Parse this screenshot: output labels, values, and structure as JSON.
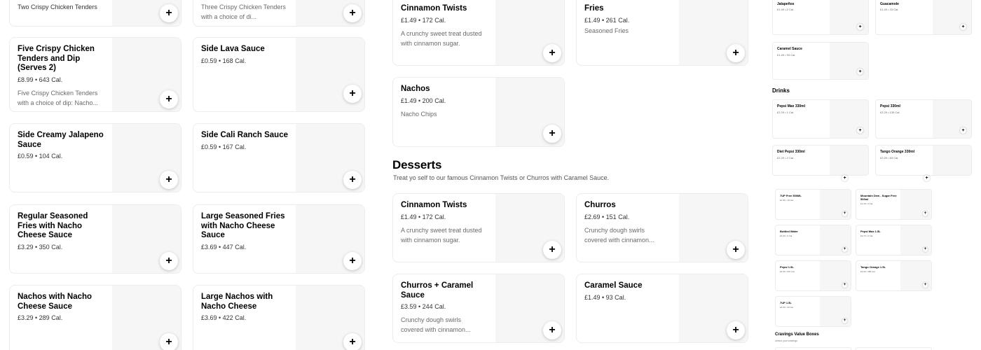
{
  "add_icon": "+",
  "col1": [
    {
      "name": "Two Crispy Chicken Tenders",
      "meta": "",
      "desc": ""
    },
    {
      "name": "Five Crispy Chicken Tenders and Dip (Serves 2)",
      "meta": "£8.99 • 643 Cal.",
      "desc": "Five Crispy Chicken Tenders with a choice of dip: Nacho..."
    },
    {
      "name": "Side Creamy Jalapeno Sauce",
      "meta": "£0.59 • 104 Cal.",
      "desc": ""
    },
    {
      "name": "Regular Seasoned Fries with Nacho Cheese Sauce",
      "meta": "£3.29 • 350 Cal.",
      "desc": ""
    },
    {
      "name": "Nachos with Nacho Cheese Sauce",
      "meta": "£3.29 • 289 Cal.",
      "desc": ""
    }
  ],
  "col2": [
    {
      "name": "",
      "meta": "",
      "desc": "Three Crispy Chicken Tenders with a choice of di..."
    },
    {
      "name": "Side Lava Sauce",
      "meta": "£0.59 • 168 Cal.",
      "desc": ""
    },
    {
      "name": "Side Cali Ranch Sauce",
      "meta": "£0.59 • 167 Cal.",
      "desc": ""
    },
    {
      "name": "Large Seasoned Fries with Nacho Cheese Sauce",
      "meta": "£3.69 • 447 Cal.",
      "desc": ""
    },
    {
      "name": "Large Nachos with Nacho Cheese",
      "meta": "£3.69 • 422 Cal.",
      "desc": ""
    }
  ],
  "col3_top": [
    {
      "name": "Cinnamon Twists",
      "meta": "£1.49 • 172 Cal.",
      "desc": "A crunchy sweet treat dusted with cinnamon sugar."
    },
    {
      "name": "Nachos",
      "meta": "£1.49 • 200 Cal.",
      "desc": "Nacho Chips"
    }
  ],
  "col4_top": [
    {
      "name": "Fries",
      "meta": "£1.49 • 261 Cal.",
      "desc": "Seasoned Fries"
    }
  ],
  "desserts": {
    "title": "Desserts",
    "subtitle": "Treat yo self to our famous Cinnamon Twists or Churros with Caramel Sauce.",
    "items": [
      {
        "name": "Cinnamon Twists",
        "meta": "£1.49 • 172 Cal.",
        "desc": "A crunchy sweet treat dusted with cinnamon sugar."
      },
      {
        "name": "Churros",
        "meta": "£2.69 • 151 Cal.",
        "desc": "Crunchy dough swirls covered with cinnamon..."
      },
      {
        "name": "Churros + Caramel Sauce",
        "meta": "£3.59 • 244 Cal.",
        "desc": "Crunchy dough swirls covered with cinnamon..."
      },
      {
        "name": "Caramel Sauce",
        "meta": "£1.49 • 93 Cal.",
        "desc": ""
      }
    ]
  },
  "mini": {
    "top": [
      {
        "name": "Jalapeños",
        "meta": "£1.49 • 2 Cal."
      },
      {
        "name": "Guacamole",
        "meta": "£1.49 • 23 Cal."
      },
      {
        "name": "Caramel Sauce",
        "meta": "£1.49 • 93 Cal."
      }
    ],
    "drinks_title": "Drinks",
    "drinks": [
      {
        "name": "Pepsi Max 330ml",
        "meta": "£2.29 • 1 Cal."
      },
      {
        "name": "Pepsi 330ml",
        "meta": "£2.29 • 135 Cal."
      },
      {
        "name": "Diet Pepsi 330ml",
        "meta": "£2.29 • 2 Cal."
      },
      {
        "name": "Tango Orange 330ml",
        "meta": "£2.29 • 63 Cal."
      },
      {
        "name": "7UP Free 500ML",
        "meta": "£1.99 • 10 Cal."
      },
      {
        "name": "Mountain Dew - Sugar Free 500ml",
        "meta": "£1.49 • 9 Cal."
      },
      {
        "name": "Bottled Water",
        "meta": "£1.99 • 0 Cal."
      },
      {
        "name": "Pepsi Max 1.5L",
        "meta": "£3.79 • 9 Cal."
      },
      {
        "name": "Pepsi 1.5L",
        "meta": "£4.99 • 615 Cal."
      },
      {
        "name": "Tango Orange 1.5L",
        "meta": "£4.99 • 285 Cal."
      },
      {
        "name": "7UP 1.5L",
        "meta": "£4.99 • 30 Cal."
      }
    ],
    "cravings_title": "Cravings Value Boxes",
    "cravings_sub": "Unbox your cravings"
  }
}
